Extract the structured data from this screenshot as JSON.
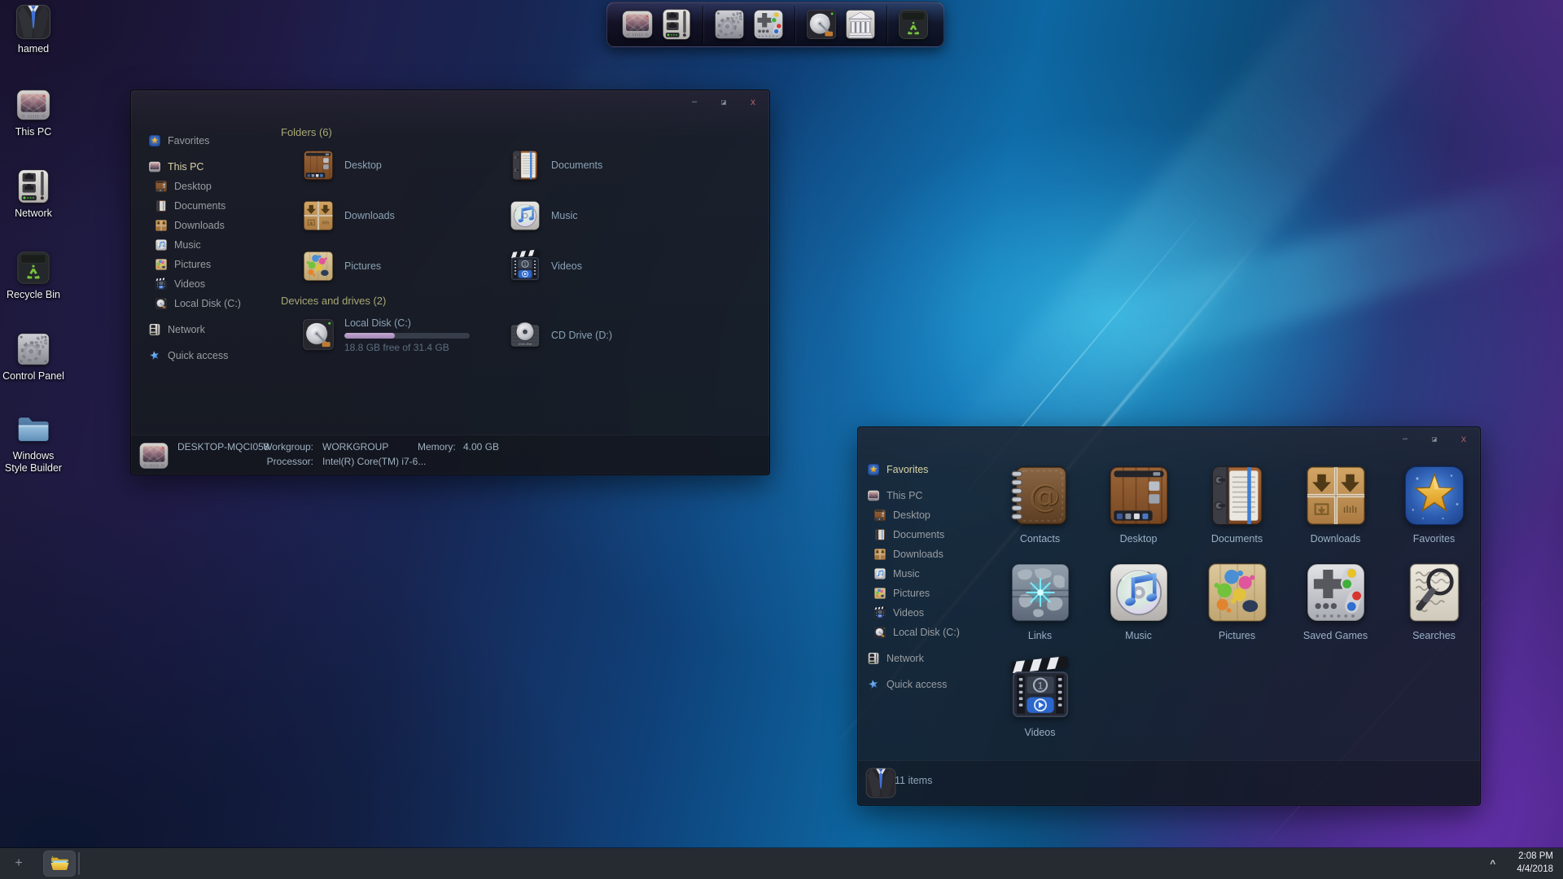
{
  "desktop": {
    "icons": [
      {
        "label": "hamed",
        "icon": "user-suit"
      },
      {
        "label": "This PC",
        "icon": "retro-tv"
      },
      {
        "label": "Network",
        "icon": "network-switch"
      },
      {
        "label": "Recycle Bin",
        "icon": "recycle-bin"
      },
      {
        "label": "Control Panel",
        "icon": "control-panel-gears"
      },
      {
        "label": "Windows Style Builder",
        "icon": "blue-folder"
      }
    ]
  },
  "dock": {
    "items": [
      {
        "name": "this-pc",
        "icon": "retro-tv"
      },
      {
        "name": "network",
        "icon": "network-switch"
      },
      {
        "name": "control-panel",
        "icon": "control-panel-gears"
      },
      {
        "name": "games",
        "icon": "gamepad"
      },
      {
        "name": "hard-drive",
        "icon": "hard-drive"
      },
      {
        "name": "libraries",
        "icon": "museum-building"
      },
      {
        "name": "recycle-bin",
        "icon": "recycle-bin"
      }
    ]
  },
  "window_controls": {
    "minimize": "–",
    "close": "x"
  },
  "explorer_this_pc": {
    "sidebar": {
      "items": [
        {
          "label": "Favorites",
          "icon": "favorites-star"
        },
        {
          "label": "This PC",
          "icon": "retro-tv",
          "selected": true
        },
        {
          "label": "Desktop",
          "icon": "desktop-wood"
        },
        {
          "label": "Documents",
          "icon": "documents-notebook"
        },
        {
          "label": "Downloads",
          "icon": "downloads-crate"
        },
        {
          "label": "Music",
          "icon": "music-cd"
        },
        {
          "label": "Pictures",
          "icon": "pictures-paint"
        },
        {
          "label": "Videos",
          "icon": "videos-clapper"
        },
        {
          "label": "Local Disk (C:)",
          "icon": "hard-drive"
        },
        {
          "label": "Network",
          "icon": "network-switch"
        },
        {
          "label": "Quick access",
          "icon": "quick-access-star"
        }
      ]
    },
    "folders_section": {
      "title": "Folders (6)",
      "items": [
        {
          "label": "Desktop",
          "icon": "desktop-wood"
        },
        {
          "label": "Documents",
          "icon": "documents-notebook"
        },
        {
          "label": "Downloads",
          "icon": "downloads-crate"
        },
        {
          "label": "Music",
          "icon": "music-cd"
        },
        {
          "label": "Pictures",
          "icon": "pictures-paint"
        },
        {
          "label": "Videos",
          "icon": "videos-clapper"
        }
      ]
    },
    "drives_section": {
      "title": "Devices and drives (2)",
      "items": [
        {
          "label": "Local Disk (C:)",
          "icon": "hard-drive",
          "free_text": "18.8 GB free of 31.4 GB",
          "used_percent": "40%"
        },
        {
          "label": "CD Drive (D:)",
          "icon": "cd-drive",
          "media_label": "DVD-RW"
        }
      ]
    },
    "status": {
      "computer_name": "DESKTOP-MQCI058",
      "workgroup_label": "Workgroup:",
      "workgroup_value": "WORKGROUP",
      "memory_label": "Memory:",
      "memory_value": "4.00 GB",
      "processor_label": "Processor:",
      "processor_value": "Intel(R) Core(TM) i7-6..."
    }
  },
  "explorer_user": {
    "sidebar": {
      "items": [
        {
          "label": "Favorites",
          "icon": "favorites-star",
          "selected": true
        },
        {
          "label": "This PC",
          "icon": "retro-tv"
        },
        {
          "label": "Desktop",
          "icon": "desktop-wood"
        },
        {
          "label": "Documents",
          "icon": "documents-notebook"
        },
        {
          "label": "Downloads",
          "icon": "downloads-crate"
        },
        {
          "label": "Music",
          "icon": "music-cd"
        },
        {
          "label": "Pictures",
          "icon": "pictures-paint"
        },
        {
          "label": "Videos",
          "icon": "videos-clapper"
        },
        {
          "label": "Local Disk (C:)",
          "icon": "hard-drive"
        },
        {
          "label": "Network",
          "icon": "network-switch"
        },
        {
          "label": "Quick access",
          "icon": "quick-access-star"
        }
      ]
    },
    "items": [
      {
        "label": "Contacts",
        "icon": "contacts-book"
      },
      {
        "label": "Desktop",
        "icon": "desktop-wood"
      },
      {
        "label": "Documents",
        "icon": "documents-notebook"
      },
      {
        "label": "Downloads",
        "icon": "downloads-crate"
      },
      {
        "label": "Favorites",
        "icon": "favorites-star"
      },
      {
        "label": "Links",
        "icon": "links-globe"
      },
      {
        "label": "Music",
        "icon": "music-cd"
      },
      {
        "label": "Pictures",
        "icon": "pictures-paint"
      },
      {
        "label": "Saved Games",
        "icon": "gamepad"
      },
      {
        "label": "Searches",
        "icon": "searches-magnifier"
      },
      {
        "label": "Videos",
        "icon": "videos-clapper"
      }
    ],
    "status": {
      "items_count": "11 items"
    }
  },
  "taskbar": {
    "new_window_button": "+",
    "tray_expand": "^",
    "clock": {
      "time": "2:08 PM",
      "date": "4/4/2018"
    }
  },
  "colors": {
    "selected_sidebar_text": "#d9d2a4",
    "section_header_text": "#a8a876",
    "item_label_text": "#8ba2b6",
    "progress_fill": "#b39bc8",
    "taskbar_bg": "#262a31"
  }
}
